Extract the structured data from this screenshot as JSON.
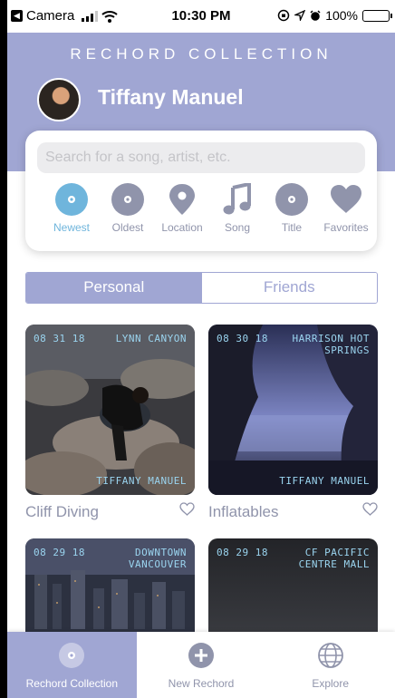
{
  "status_bar": {
    "back_app": "Camera",
    "time": "10:30 PM",
    "battery": "100%"
  },
  "header": {
    "app_title": "RECHORD COLLECTION",
    "user_name": "Tiffany Manuel"
  },
  "search": {
    "placeholder": "Search for a song, artist, etc.",
    "value": ""
  },
  "filters": [
    {
      "label": "Newest",
      "icon": "record-icon",
      "active": true
    },
    {
      "label": "Oldest",
      "icon": "record-icon",
      "active": false
    },
    {
      "label": "Location",
      "icon": "location-pin-icon",
      "active": false
    },
    {
      "label": "Song",
      "icon": "music-note-icon",
      "active": false
    },
    {
      "label": "Title",
      "icon": "record-icon",
      "active": false
    },
    {
      "label": "Favorites",
      "icon": "heart-icon",
      "active": false
    }
  ],
  "tabs": {
    "personal": "Personal",
    "friends": "Friends",
    "active": "personal"
  },
  "cards": [
    {
      "date": "08 31 18",
      "location": "LYNN CANYON",
      "owner": "TIFFANY MANUEL",
      "title": "Cliff Diving"
    },
    {
      "date": "08 30 18",
      "location": "HARRISON HOT SPRINGS",
      "owner": "TIFFANY MANUEL",
      "title": "Inflatables"
    },
    {
      "date": "08 29 18",
      "location": "DOWNTOWN VANCOUVER",
      "owner": "",
      "title": ""
    },
    {
      "date": "08 29 18",
      "location": "CF PACIFIC CENTRE MALL",
      "owner": "",
      "title": ""
    }
  ],
  "tab_bar": [
    {
      "label": "Rechord Collection",
      "icon": "record-icon",
      "active": true
    },
    {
      "label": "New Rechord",
      "icon": "plus-circle-icon",
      "active": false
    },
    {
      "label": "Explore",
      "icon": "globe-icon",
      "active": false
    }
  ],
  "colors": {
    "brand": "#a0a6d3",
    "active_filter": "#6fb5dc",
    "muted_text": "#9094ab",
    "overlay_text": "#9ad4ef"
  }
}
